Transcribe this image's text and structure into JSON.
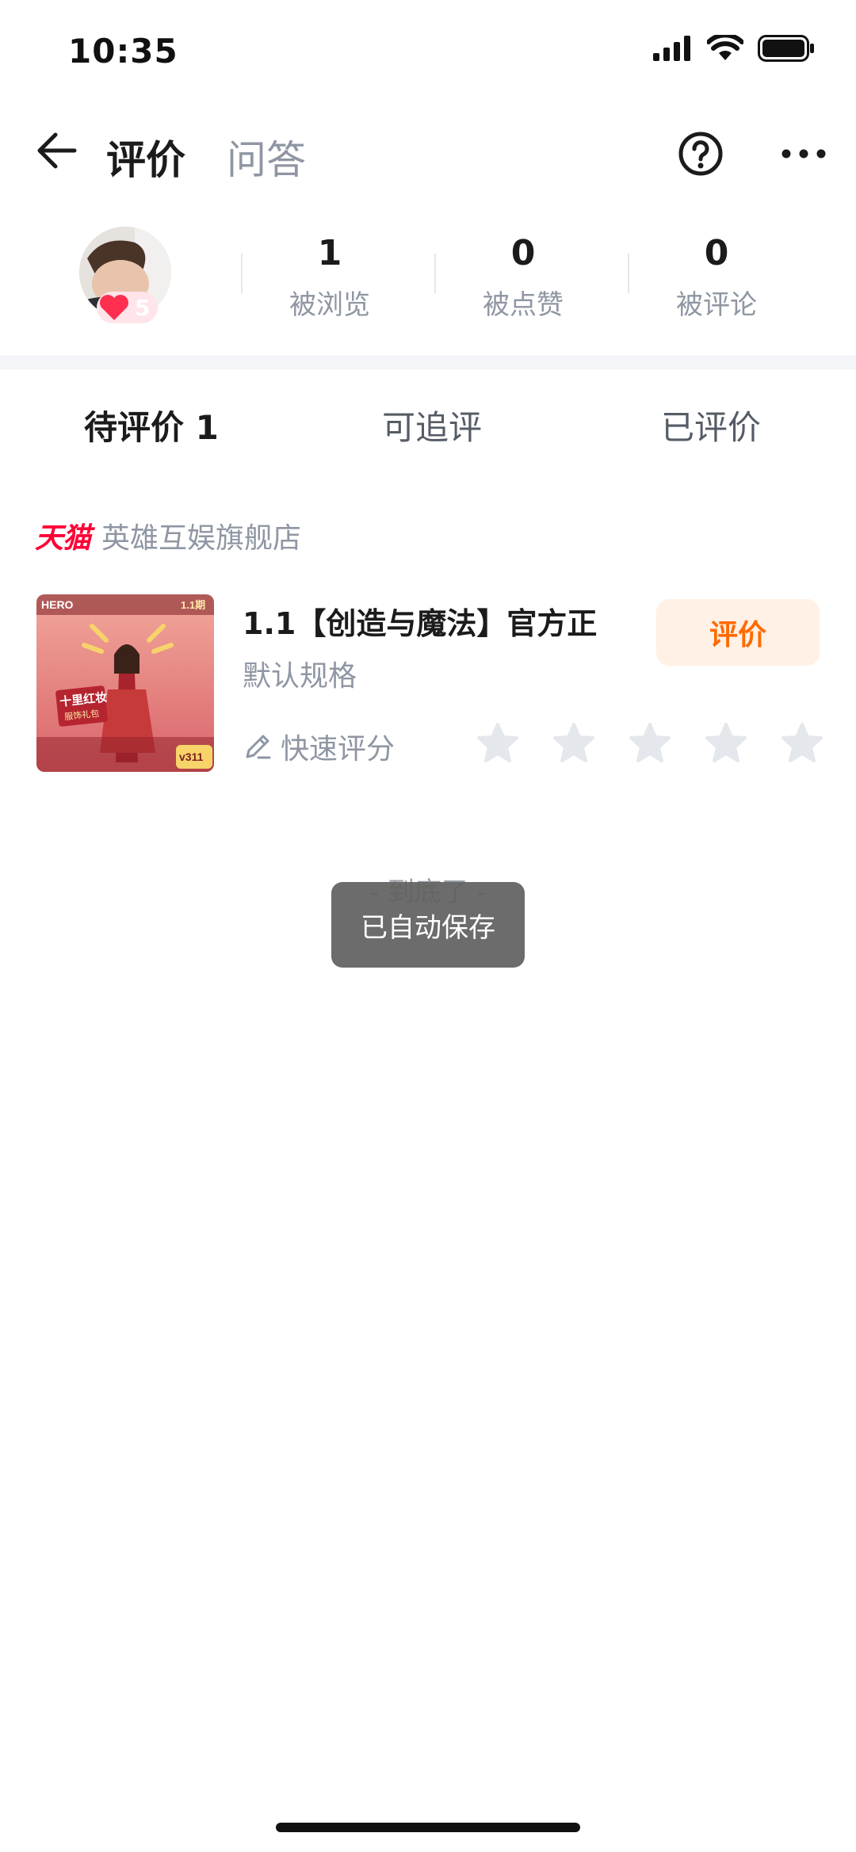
{
  "status_bar": {
    "time": "10:35"
  },
  "header": {
    "tabs": [
      {
        "label": "评价",
        "active": true
      },
      {
        "label": "问答",
        "active": false
      }
    ]
  },
  "profile": {
    "level": "5",
    "stats": [
      {
        "value": "1",
        "label": "被浏览"
      },
      {
        "value": "0",
        "label": "被点赞"
      },
      {
        "value": "0",
        "label": "被评论"
      }
    ]
  },
  "sub_tabs": [
    {
      "label": "待评价 1",
      "active": true
    },
    {
      "label": "可追评",
      "active": false
    },
    {
      "label": "已评价",
      "active": false
    }
  ],
  "store": {
    "platform": "天猫",
    "name": "英雄互娱旗舰店"
  },
  "product": {
    "title": "1.1【创造与魔法】官方正",
    "spec": "默认规格",
    "review_button": "评价",
    "quick_rate_label": "快速评分",
    "stars_selected": 0,
    "stars_total": 5,
    "image_texts": {
      "brand": "HERO",
      "tag": "1.1期",
      "banner_line1": "十里红妆",
      "banner_line2": "服饰礼包",
      "price": "v311"
    }
  },
  "footer": {
    "end_text": "- 到底了 -"
  },
  "toast": {
    "text": "已自动保存"
  },
  "colors": {
    "accent": "#ff6a00",
    "tmall": "#ff0036",
    "muted": "#8f96a3"
  }
}
